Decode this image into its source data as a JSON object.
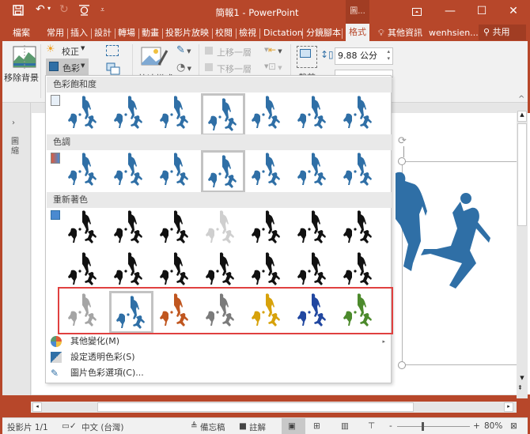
{
  "titlebar": {
    "title": "簡報1 - PowerPoint",
    "context_tab_group": "圖...",
    "quick_access": [
      "save-icon",
      "undo-icon",
      "redo-icon",
      "present-from-start-icon",
      "customize-qat-icon"
    ],
    "window_buttons": [
      "ribbon-display-options",
      "minimize",
      "maximize",
      "close"
    ]
  },
  "tabs": {
    "items": [
      "檔案",
      "常用",
      "插入",
      "設計",
      "轉場",
      "動畫",
      "投影片放映",
      "校閱",
      "檢視",
      "Dictation",
      "分鏡腳本"
    ],
    "active": "格式",
    "tell_me": "其他資訊",
    "user": "wenhsien...",
    "share": "共用"
  },
  "ribbon": {
    "remove_background": "移除背景",
    "corrections": "校正",
    "color": "色彩",
    "quick_styles": "快速樣式",
    "bring_forward": "上移一層",
    "send_backward": "下移一層",
    "crop": "裁剪",
    "height_value": "9.88 公分"
  },
  "thumbnails_pane": {
    "label": "圖\n縮"
  },
  "color_menu": {
    "sections": [
      {
        "title": "色彩飽和度",
        "variants": [
          "#2f6fa6",
          "#2f6fa6",
          "#2f6fa6",
          "#2f6fa6",
          "#2f6fa6",
          "#2f6fa6",
          "#2f6fa6"
        ],
        "selected": 3
      },
      {
        "title": "色調",
        "variants": [
          "#2f6fa6",
          "#2f6fa6",
          "#2f6fa6",
          "#2f6fa6",
          "#2f6fa6",
          "#2f6fa6",
          "#2f6fa6"
        ],
        "selected": 3
      },
      {
        "title": "重新著色",
        "rows": [
          [
            "#111111",
            "#111111",
            "#111111",
            "#cfcfcf",
            "#111111",
            "#111111",
            "#111111"
          ],
          [
            "#111111",
            "#111111",
            "#111111",
            "#111111",
            "#111111",
            "#111111",
            "#111111"
          ],
          [
            "#a5a5a5",
            "#2f6fa6",
            "#c0561f",
            "#7b7b7b",
            "#d7a20b",
            "#2147a0",
            "#4c8a2c"
          ]
        ],
        "selected_row": 2,
        "selected": 1
      }
    ],
    "items": [
      {
        "label": "其他變化(M)",
        "has_submenu": true
      },
      {
        "label": "設定透明色彩(S)",
        "has_submenu": false
      },
      {
        "label": "圖片色彩選項(C)...",
        "has_submenu": false
      }
    ]
  },
  "statusbar": {
    "slide": "投影片 1/1",
    "language": "中文 (台灣)",
    "notes": "備忘稿",
    "comments": "註解",
    "zoom": "80%",
    "zoom_level_percent": 80
  },
  "colors": {
    "accent": "#b7472a",
    "highlight_box": "#e0403f",
    "image_blue": "#2f6fa6"
  }
}
